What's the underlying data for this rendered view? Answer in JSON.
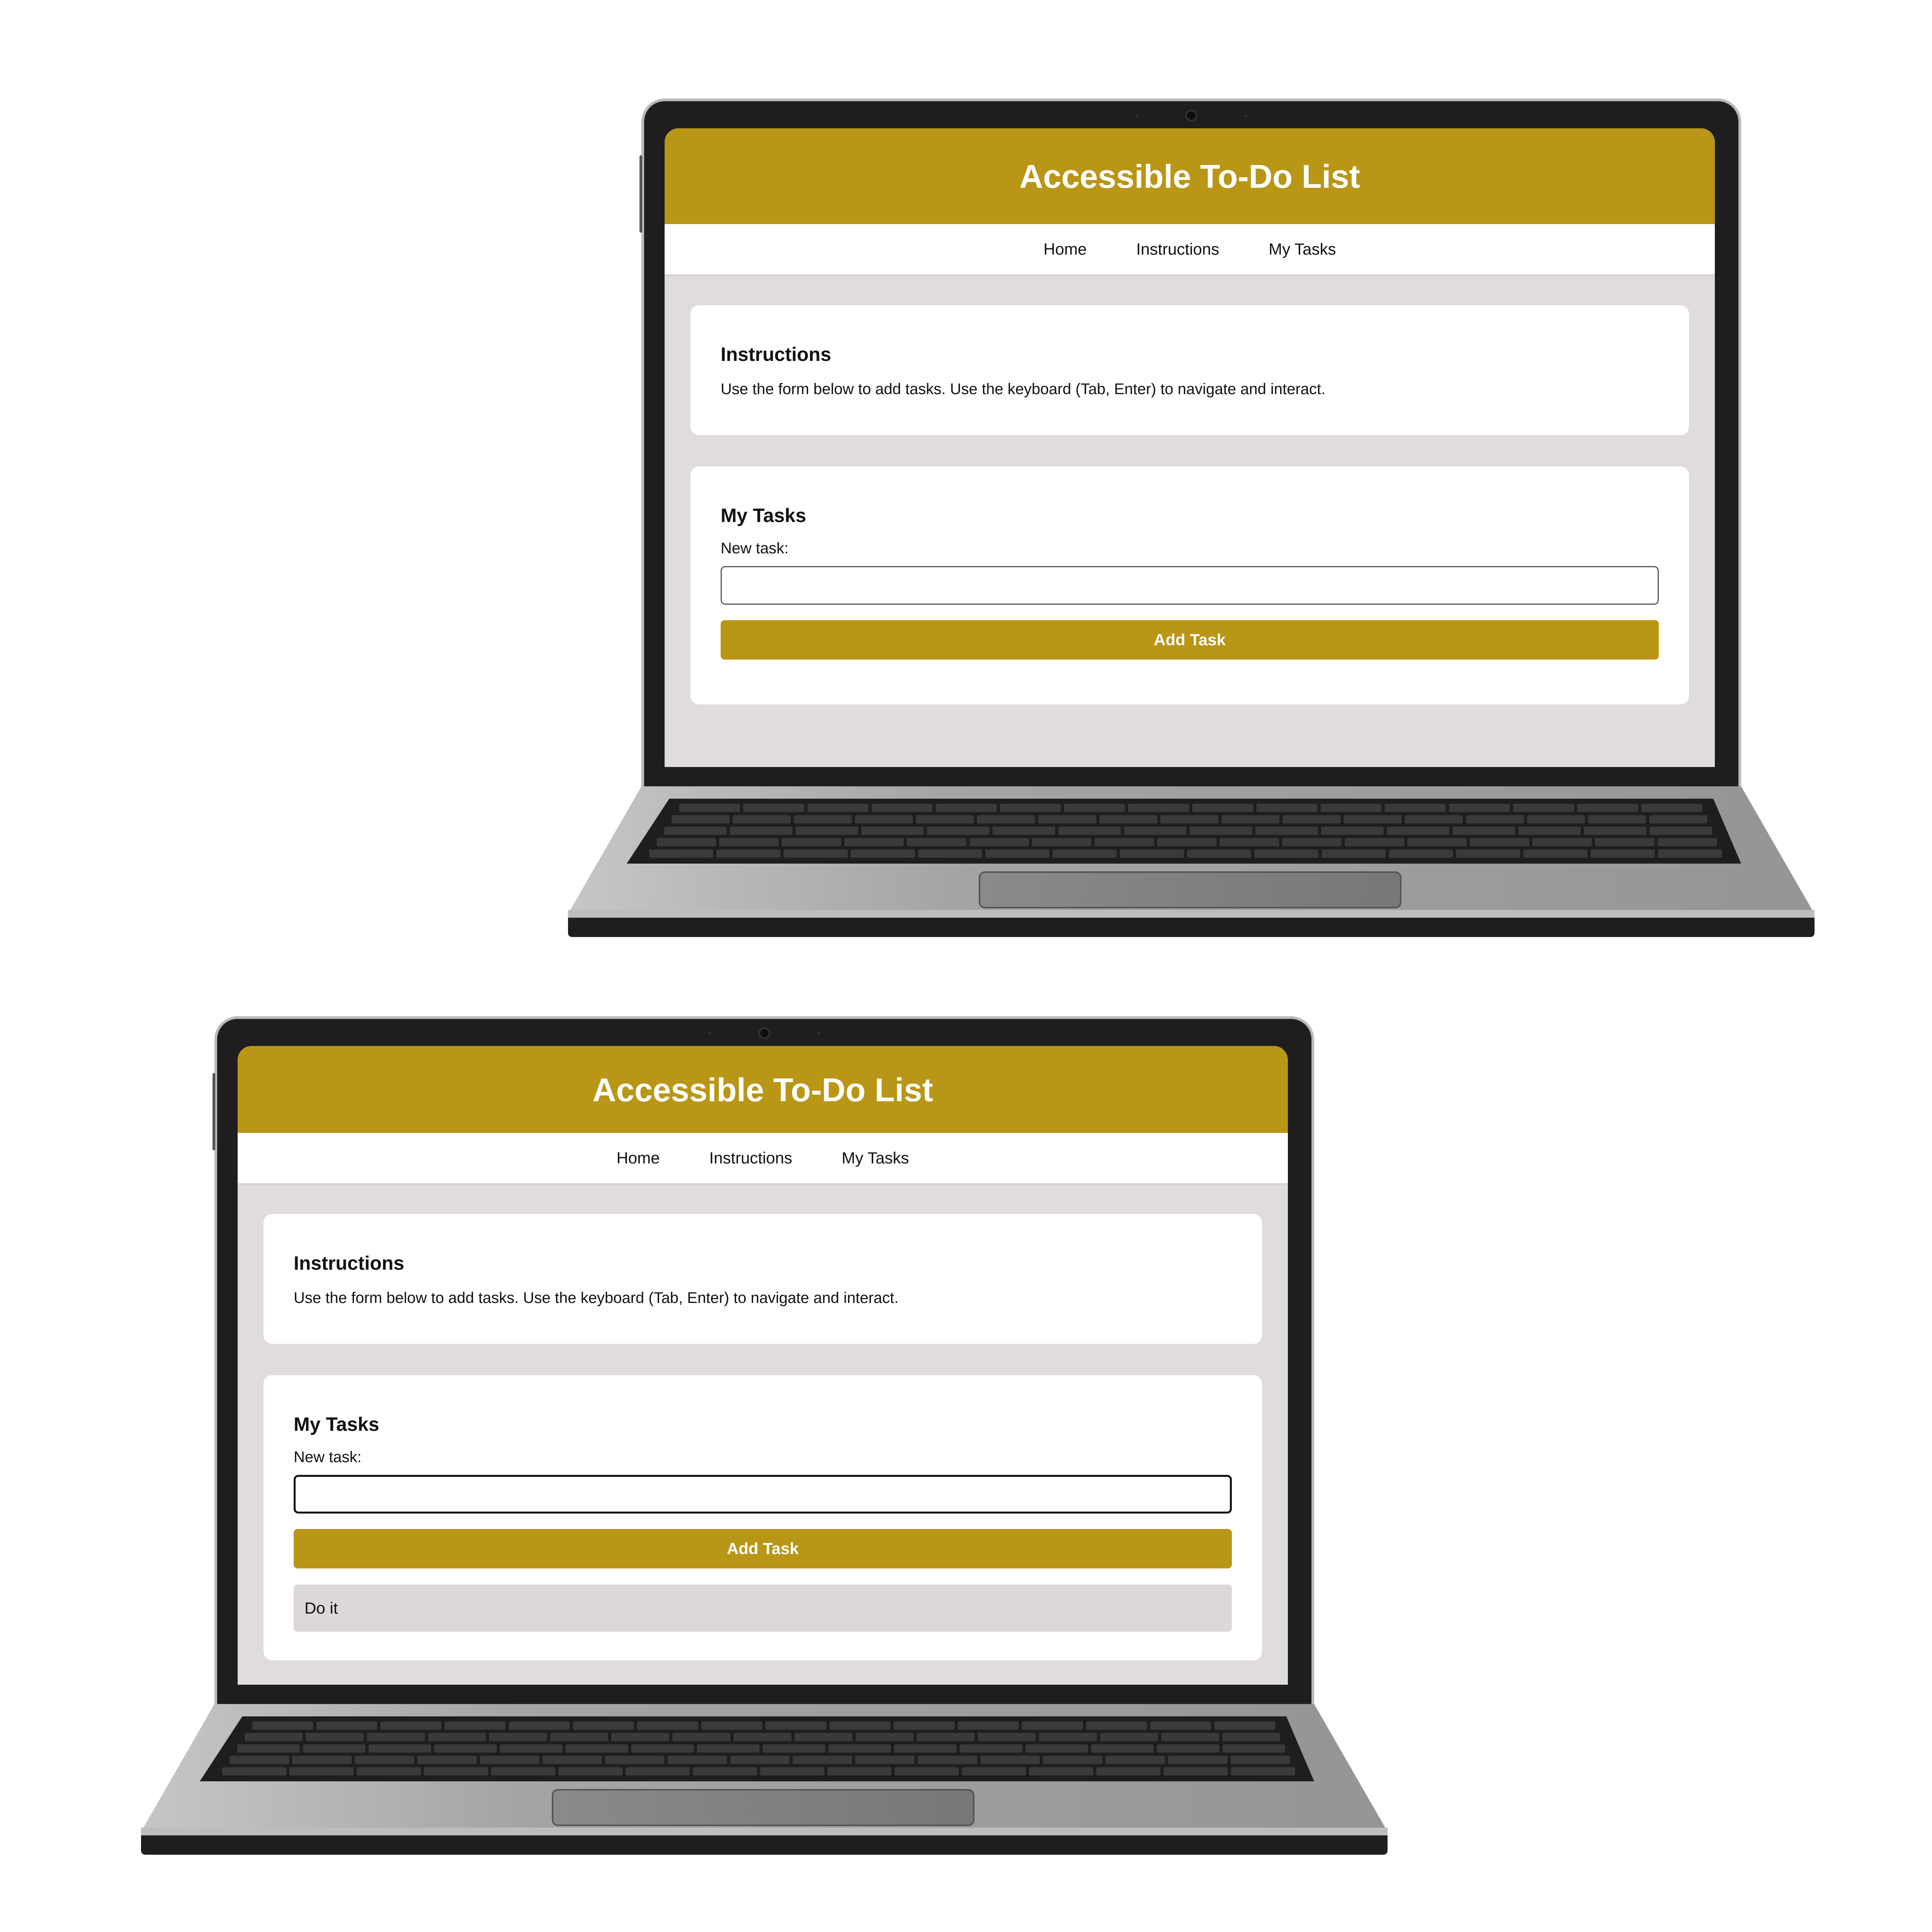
{
  "screens": [
    {
      "app": {
        "title": "Accessible To-Do List",
        "nav": [
          "Home",
          "Instructions",
          "My Tasks"
        ]
      },
      "instructions": {
        "heading": "Instructions",
        "text": "Use the form below to add tasks. Use the keyboard (Tab, Enter) to navigate and interact."
      },
      "tasks": {
        "heading": "My Tasks",
        "input_label": "New task:",
        "input_value": "",
        "add_button_label": "Add Task",
        "items": []
      }
    },
    {
      "app": {
        "title": "Accessible To-Do List",
        "nav": [
          "Home",
          "Instructions",
          "My Tasks"
        ]
      },
      "instructions": {
        "heading": "Instructions",
        "text": "Use the form below to add tasks. Use the keyboard (Tab, Enter) to navigate and interact."
      },
      "tasks": {
        "heading": "My Tasks",
        "input_label": "New task:",
        "input_value": "",
        "add_button_label": "Add Task",
        "items": [
          "Do it"
        ]
      }
    }
  ],
  "colors": {
    "accent": "#b99616",
    "page_background": "#e1dcdc",
    "card_background": "#ffffff",
    "task_item_background": "#dcd8d8",
    "laptop_bezel": "#1e1e1e",
    "laptop_body": "#a8a8a8"
  }
}
